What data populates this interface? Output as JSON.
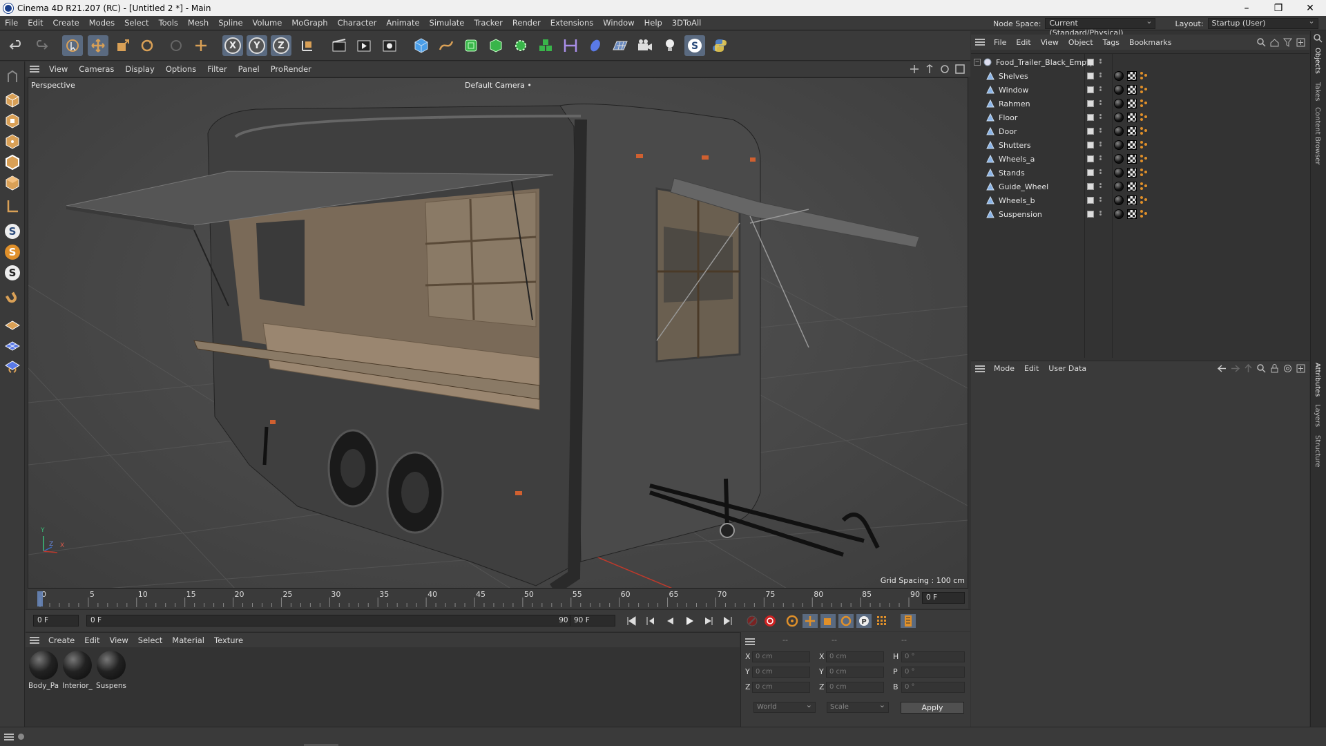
{
  "window": {
    "title": "Cinema 4D R21.207 (RC) - [Untitled 2 *] - Main",
    "minimize": "–",
    "maximize": "❐",
    "close": "✕"
  },
  "menubar": [
    "File",
    "Edit",
    "Create",
    "Modes",
    "Select",
    "Tools",
    "Mesh",
    "Spline",
    "Volume",
    "MoGraph",
    "Character",
    "Animate",
    "Simulate",
    "Tracker",
    "Render",
    "Extensions",
    "Window",
    "Help",
    "3DToAll"
  ],
  "nodespace": {
    "label": "Node Space:",
    "value": "Current (Standard/Physical)"
  },
  "layout": {
    "label": "Layout:",
    "value": "Startup (User)"
  },
  "toolbar": {
    "axis_x": "X",
    "axis_y": "Y",
    "axis_z": "Z"
  },
  "lefttools": {
    "s1": "S",
    "s2": "S",
    "s3": "S"
  },
  "viewport": {
    "menu": [
      "View",
      "Cameras",
      "Display",
      "Options",
      "Filter",
      "Panel",
      "ProRender"
    ],
    "view_name": "Perspective",
    "camera": "Default Camera",
    "camera_icon": "•",
    "grid_spacing": "Grid Spacing : 100 cm",
    "axis_y": "Y",
    "axis_z": "Z",
    "axis_x": "X"
  },
  "timeline": {
    "ticks": [
      "0",
      "5",
      "10",
      "15",
      "20",
      "25",
      "30",
      "35",
      "40",
      "45",
      "50",
      "55",
      "60",
      "65",
      "70",
      "75",
      "80",
      "85",
      "90"
    ],
    "current_frame": "0 F",
    "current_frame_value": 0
  },
  "transport": {
    "start_field": "0 F",
    "range_start": "0 F",
    "range_end": "90 F",
    "end_field": "90 F"
  },
  "material_manager": {
    "menu": [
      "Create",
      "Edit",
      "View",
      "Select",
      "Material",
      "Texture"
    ],
    "materials": [
      "Body_Pa",
      "Interior_",
      "Suspens"
    ]
  },
  "coordinates": {
    "header_pos": "--",
    "header_size": "--",
    "header_rot": "--",
    "rows": [
      {
        "label": "X",
        "pos": "0 cm",
        "size_label": "X",
        "size": "0 cm",
        "rot_label": "H",
        "rot": "0 °"
      },
      {
        "label": "Y",
        "pos": "0 cm",
        "size_label": "Y",
        "size": "0 cm",
        "rot_label": "P",
        "rot": "0 °"
      },
      {
        "label": "Z",
        "pos": "0 cm",
        "size_label": "Z",
        "size": "0 cm",
        "rot_label": "B",
        "rot": "0 °"
      }
    ],
    "coord_system": "World",
    "mode": "Scale",
    "apply": "Apply"
  },
  "object_manager": {
    "menu": [
      "File",
      "Edit",
      "View",
      "Object",
      "Tags",
      "Bookmarks"
    ],
    "root": "Food_Trailer_Black_Empty",
    "children": [
      "Shelves",
      "Window",
      "Rahmen",
      "Floor",
      "Door",
      "Shutters",
      "Wheels_a",
      "Stands",
      "Guide_Wheel",
      "Wheels_b",
      "Suspension"
    ]
  },
  "attribute_manager": {
    "menu": [
      "Mode",
      "Edit",
      "User Data"
    ]
  },
  "side_tabs": [
    "Objects",
    "Takes",
    "Content Browser",
    "Attributes",
    "Layers",
    "Structure"
  ],
  "colors": {
    "accent_blue": "#5a6a80",
    "orange": "#e0902a",
    "record_red": "#cc2222"
  }
}
